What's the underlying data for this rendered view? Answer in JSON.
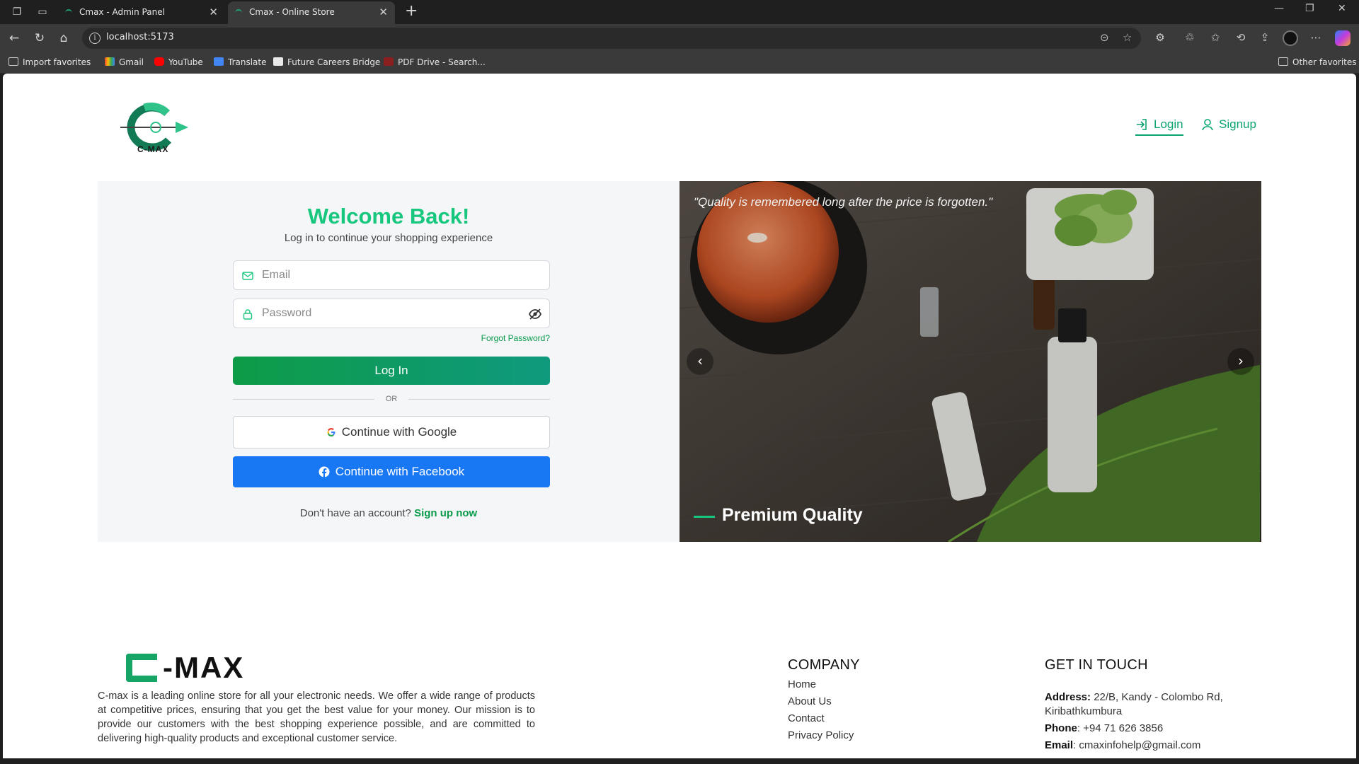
{
  "browser": {
    "tabs": [
      {
        "title": "Cmax - Admin Panel",
        "active": false
      },
      {
        "title": "Cmax - Online Store",
        "active": true
      }
    ],
    "url": "localhost:5173",
    "favorites": [
      {
        "label": "Import favorites",
        "icon": "import-icon"
      },
      {
        "label": "Gmail",
        "icon": "gmail-icon"
      },
      {
        "label": "YouTube",
        "icon": "youtube-icon"
      },
      {
        "label": "Translate",
        "icon": "translate-icon"
      },
      {
        "label": "Future Careers Bridge",
        "icon": "site-icon"
      },
      {
        "label": "PDF Drive - Search...",
        "icon": "pdf-icon"
      }
    ],
    "other_favorites": "Other favorites"
  },
  "header": {
    "logo_text": "C-MAX",
    "login_label": "Login",
    "signup_label": "Signup"
  },
  "login": {
    "title": "Welcome Back!",
    "subtitle": "Log in to continue your shopping experience",
    "email_placeholder": "Email",
    "password_placeholder": "Password",
    "forgot_password": "Forgot Password?",
    "login_button": "Log In",
    "or_text": "OR",
    "google_button": "Continue with Google",
    "facebook_button": "Continue with Facebook",
    "no_account_text": "Don't have an account?",
    "signup_link": "Sign up now"
  },
  "hero": {
    "quote": "\"Quality is remembered long after the price is forgotten.\"",
    "title": "Premium Quality"
  },
  "footer": {
    "logo_text": "-MAX",
    "about": "C-max is a leading online store for all your electronic needs. We offer a wide range of products at competitive prices, ensuring that you get the best value for your money. Our mission is to provide our customers with the best shopping experience possible, and are committed to delivering high-quality products and exceptional customer service.",
    "company_heading": "COMPANY",
    "company_links": [
      "Home",
      "About Us",
      "Contact",
      "Privacy Policy"
    ],
    "contact_heading": "GET IN TOUCH",
    "address_label": "Address:",
    "address_value": "22/B, Kandy - Colombo Rd, Kiribathkumbura",
    "phone_label": "Phone",
    "phone_value": ": +94 71 626 3856",
    "email_label": "Email",
    "email_value": ": cmaxinfohelp@gmail.com"
  },
  "colors": {
    "accent_green": "#18c77e",
    "link_green": "#0aa372",
    "facebook_blue": "#1877f2"
  }
}
